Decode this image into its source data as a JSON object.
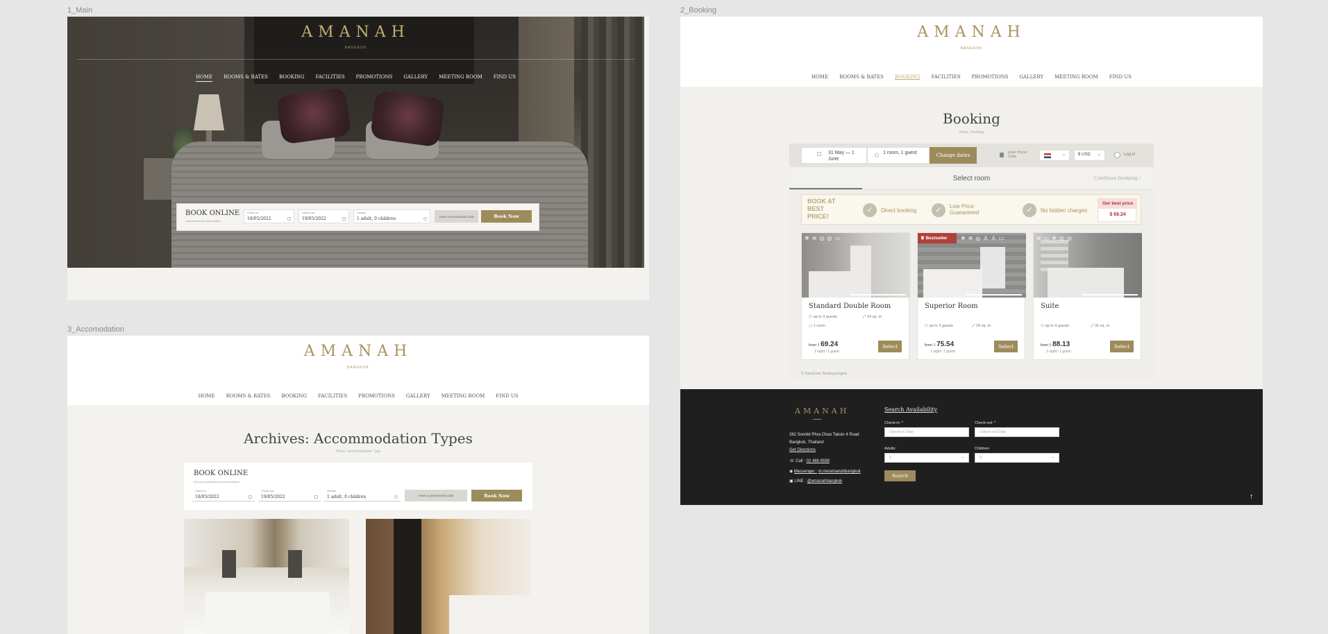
{
  "frames": {
    "main": "1_Main",
    "booking": "2_Booking",
    "accommodation": "3_Accomodation"
  },
  "brand": {
    "name": "AMANAH",
    "city": "BANGKOK",
    "accent": "#a8935b"
  },
  "nav": [
    "HOME",
    "ROOMS & RATES",
    "BOOKING",
    "FACILITIES",
    "PROMOTIONS",
    "GALLERY",
    "MEETING ROOM",
    "FIND US"
  ],
  "booking_widget": {
    "title": "BOOK ONLINE",
    "subtitle": "Guaranteed accommodation",
    "subtitle_alt": "Get your guaranteed accommodation",
    "checkin_label": "Check-in",
    "checkin_value": "18/05/2022",
    "checkout_label": "Check-out",
    "checkout_value": "19/05/2022",
    "guests_label": "Guests",
    "guests_value": "1 adult, 0 children",
    "promo": "Have a promotional code",
    "button": "Book Now"
  },
  "accommodation": {
    "title": "Archives: Accommodation Types",
    "crumb_home": "Home",
    "crumb_current": "accommodation Type"
  },
  "booking_page": {
    "title": "Booking",
    "crumb_home": "Home",
    "crumb_current": "Booking",
    "dates": "31 May — 1 June",
    "rooms": "1 room, 1 guest",
    "change_dates": "Change dates",
    "promo": "Enter Promo Code",
    "currency": "$ USD",
    "login": "Log in",
    "step": "Select room",
    "continue": "Continue booking",
    "best_price_title": "BOOK AT BEST PRICE!",
    "perks": [
      "Direct booking",
      "Low Price Guaranteed",
      "No hidden charges"
    ],
    "our_best_price_label": "Our best price",
    "our_best_price_value": "$ 69.24",
    "bestseller": "Bestseller",
    "powered": "© TravelLine: Booking Engine",
    "rooms_list": [
      {
        "name": "Standard Double Room",
        "guests": "up to 3 guests",
        "area": "24 sq. m",
        "beds": "1 room",
        "from": "from",
        "price": "69.24",
        "per": "1 night / 1 guest",
        "select": "Select"
      },
      {
        "name": "Superior Room",
        "guests": "up to 3 guests",
        "area": "29 sq. m",
        "beds": "",
        "from": "from",
        "price": "75.54",
        "per": "1 night / 1 guest",
        "select": "Select"
      },
      {
        "name": "Suite",
        "guests": "up to 4 guests",
        "area": "32 sq. m",
        "beds": "",
        "from": "from",
        "price": "88.13",
        "per": "1 night / 1 guest",
        "select": "Select"
      }
    ]
  },
  "footer": {
    "address1": "262 Sondet Phra Chao Taksin 4 Road",
    "address2": "Bangkok, Thailand",
    "directions": "Get Directions",
    "call_label": "Call :",
    "call": "02 466 6599",
    "messenger_label": "Messenger :",
    "messenger": "m.me/amanahbangkok",
    "line_label": "LINE :",
    "line": "@amanahbangkok",
    "search_title": "Search Availability",
    "checkin_label": "Check-in: *",
    "checkin_placeholder": "Check-in Date",
    "checkout_label": "Check-out: *",
    "checkout_placeholder": "Check-out Date",
    "adults_label": "Adults:",
    "adults_value": "2",
    "children_label": "Children:",
    "children_value": "0",
    "search_button": "Search"
  }
}
